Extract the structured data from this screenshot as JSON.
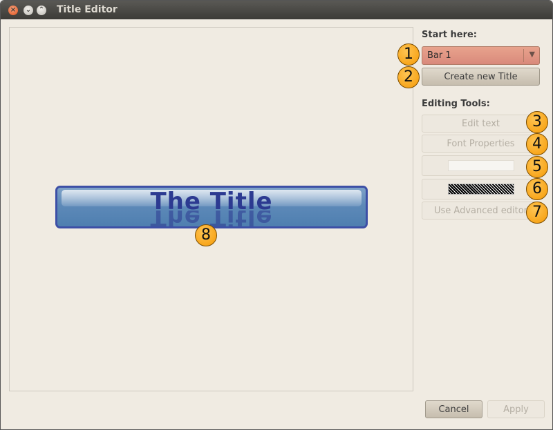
{
  "window": {
    "title": "Title Editor",
    "close_glyph": "×",
    "minimize_glyph": "⌄",
    "maximize_glyph": "⌃"
  },
  "preview": {
    "title_text": "The Title"
  },
  "sidebar": {
    "start_here_label": "Start here:",
    "bar_selector_value": "Bar 1",
    "create_button_label": "Create new Title",
    "editing_tools_label": "Editing Tools:",
    "edit_text_label": "Edit text",
    "font_properties_label": "Font Properties",
    "advanced_editor_label": "Use Advanced editor"
  },
  "footer": {
    "cancel_label": "Cancel",
    "apply_label": "Apply"
  },
  "callouts": [
    "1",
    "2",
    "3",
    "4",
    "5",
    "6",
    "7",
    "8"
  ],
  "colors": {
    "combo_bg": "#d9897b",
    "title_text": "#2c3a91",
    "title_bar_fill": "#5d89b8",
    "callout": "#f59a06"
  }
}
